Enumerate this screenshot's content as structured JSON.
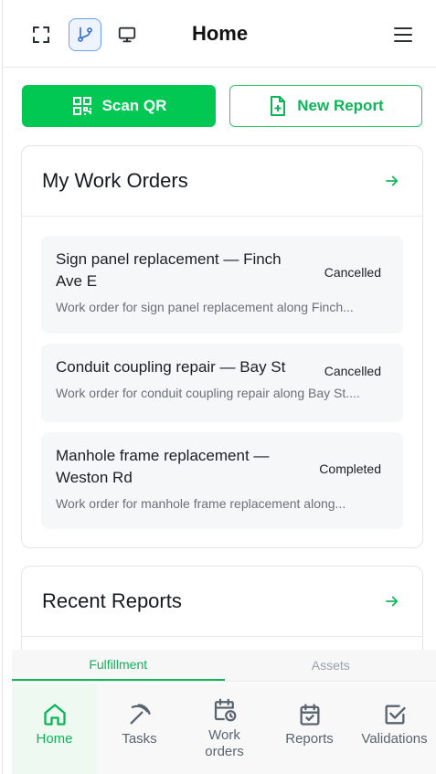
{
  "header": {
    "title": "Home",
    "icons": [
      "expand-icon",
      "git-branch-icon",
      "monitor-icon",
      "menu-icon"
    ]
  },
  "actions": {
    "scan_label": "Scan QR",
    "new_report_label": "New Report"
  },
  "work_orders": {
    "title": "My Work Orders",
    "items": [
      {
        "title": "Sign panel replacement — Finch Ave E",
        "status": "Cancelled",
        "description": "Work order for sign panel replacement along Finch..."
      },
      {
        "title": "Conduit coupling repair — Bay St",
        "status": "Cancelled",
        "description": "Work order for conduit coupling repair along Bay St...."
      },
      {
        "title": "Manhole frame replacement — Weston Rd",
        "status": "Completed",
        "description": "Work order for manhole frame replacement along..."
      }
    ]
  },
  "recent_reports": {
    "title": "Recent Reports"
  },
  "subtabs": [
    {
      "label": "Fulfillment"
    },
    {
      "label": "Assets"
    }
  ],
  "nav": [
    {
      "label": "Home"
    },
    {
      "label": "Tasks"
    },
    {
      "label": "Work orders"
    },
    {
      "label": "Reports"
    },
    {
      "label": "Validations"
    }
  ],
  "colors": {
    "brand_green": "#00c853",
    "accent_blue": "#6aa0f0"
  }
}
